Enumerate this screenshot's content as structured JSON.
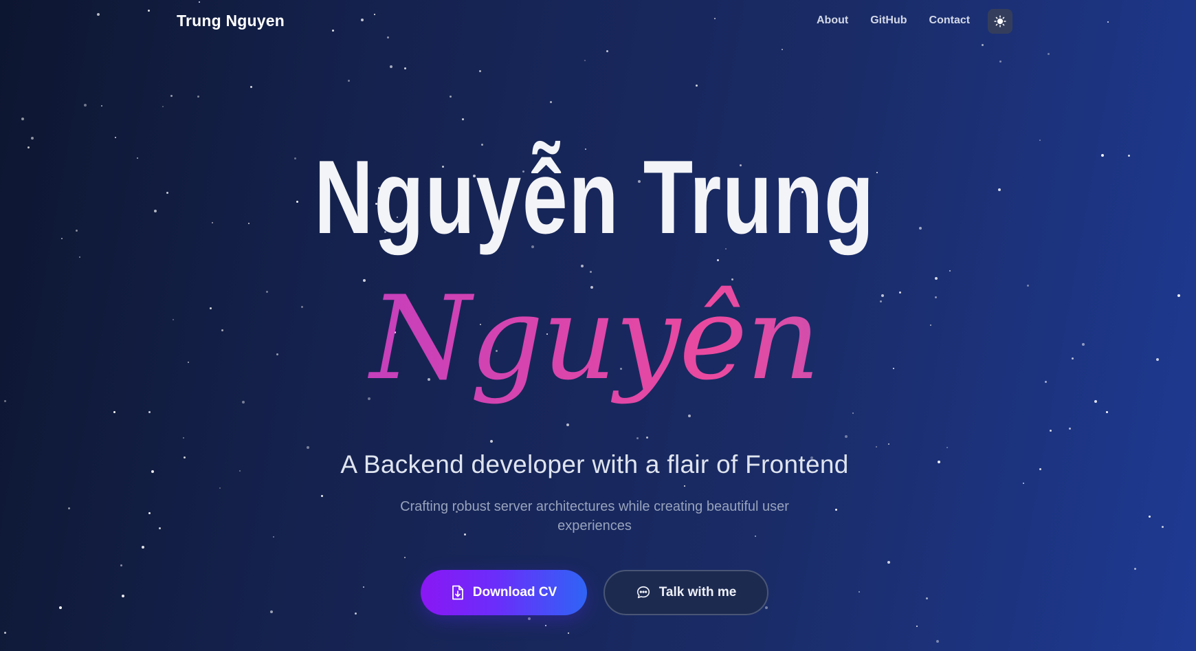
{
  "nav": {
    "brand": "Trung Nguyen",
    "links": [
      "About",
      "GitHub",
      "Contact"
    ],
    "theme_toggle_icon": "sun-icon"
  },
  "hero": {
    "title": "Nguyễn Trung",
    "script_name": "Nguyên",
    "tagline": "A Backend developer with a flair of Frontend",
    "subline": "Crafting robust server architectures while creating beautiful user experiences"
  },
  "actions": {
    "download_cv": {
      "label": "Download CV",
      "icon": "file-download-icon"
    },
    "talk": {
      "label": "Talk with me",
      "icon": "chat-bubble-icon"
    }
  },
  "colors": {
    "background_start": "#0d1630",
    "background_end": "#1e3a93",
    "primary_gradient_start": "#8a17f4",
    "primary_gradient_end": "#2f64f6",
    "script_gradient": [
      "#8b32e8",
      "#c43fbd",
      "#ea4a9f",
      "#7c5bd9"
    ]
  }
}
